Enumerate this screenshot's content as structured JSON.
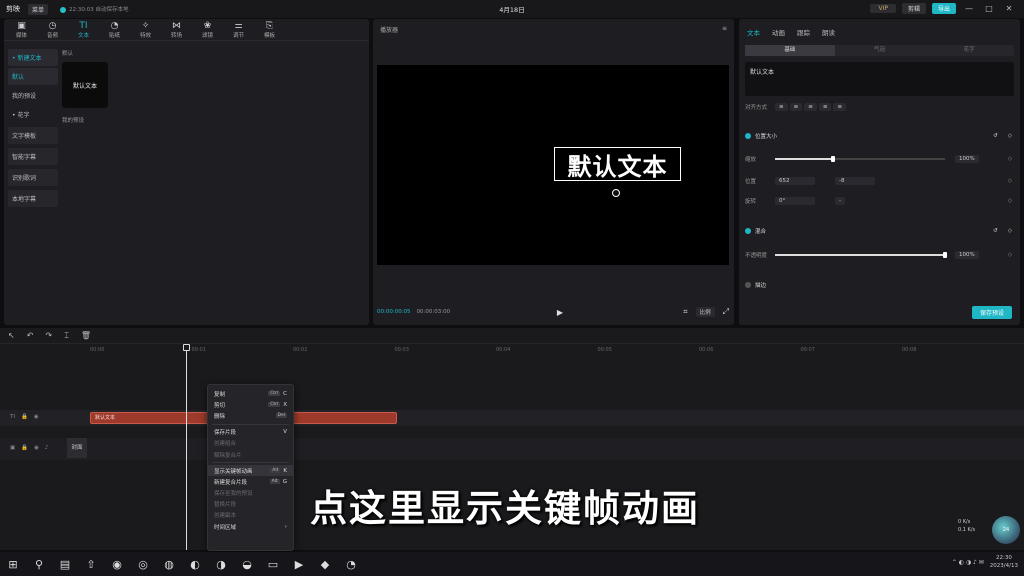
{
  "titlebar": {
    "app": "剪映",
    "menu": "菜单",
    "save_status": "22:30:03 自动保存本地",
    "date": "4月18日",
    "vip": "VIP",
    "share": "剪辑",
    "export": "导出",
    "win_min": "—",
    "win_max": "□",
    "win_close": "✕"
  },
  "left_toolbar": [
    {
      "label": "媒体",
      "icon": "▣"
    },
    {
      "label": "音频",
      "icon": "◷"
    },
    {
      "label": "文本",
      "icon": "TI",
      "active": true
    },
    {
      "label": "贴纸",
      "icon": "◔"
    },
    {
      "label": "特效",
      "icon": "✧"
    },
    {
      "label": "转场",
      "icon": "⋈"
    },
    {
      "label": "滤镜",
      "icon": "❀"
    },
    {
      "label": "调节",
      "icon": "⚌"
    },
    {
      "label": "模板",
      "icon": "⎘"
    }
  ],
  "categories": [
    {
      "label": "• 新建文本",
      "active": true
    },
    {
      "label": "默认",
      "active": true
    },
    {
      "label": "我的预设"
    },
    {
      "label": "• 花字"
    },
    {
      "label": "文字模板",
      "box": true
    },
    {
      "label": "智能字幕",
      "box": true
    },
    {
      "label": "识别歌词",
      "box": true
    },
    {
      "label": "本地字幕",
      "box": true
    }
  ],
  "presets": {
    "default_label": "默认",
    "card_text": "默认文本",
    "mine_label": "我的预设"
  },
  "preview": {
    "title": "播放器",
    "menu_icon": "≡",
    "text": "默认文本",
    "time_current": "00:00:00:05",
    "time_total": "00:00:03:00",
    "play_icon": "▶",
    "crop_icon": "⌗",
    "ratio": "比例",
    "fullscreen_icon": "⤢"
  },
  "props": {
    "tabs": [
      {
        "label": "文本",
        "on": true
      },
      {
        "label": "动画"
      },
      {
        "label": "跟踪"
      },
      {
        "label": "朗读"
      }
    ],
    "subtabs": [
      {
        "label": "基础",
        "on": true
      },
      {
        "label": "气泡"
      },
      {
        "label": "花字"
      }
    ],
    "text_value": "默认文本",
    "align_label": "对齐方式",
    "scale_section": "位置大小",
    "scale_label": "缩放",
    "scale_value": "100%",
    "scale_fraction": 0.34,
    "pos_label": "位置",
    "pos_x": "652",
    "pos_y": "-8",
    "rot_label": "旋转",
    "rot_value": "0°",
    "rot_extra": "-",
    "mix_section": "混合",
    "opacity_label": "不透明度",
    "opacity_value": "100%",
    "opacity_fraction": 1.0,
    "stroke_section": "描边",
    "apply_btn": "保存预设"
  },
  "timeline": {
    "ruler": [
      "00:00",
      "00:01",
      "00:02",
      "00:03",
      "00:04",
      "00:05",
      "00:06",
      "00:07",
      "00:08"
    ],
    "clip_label": "默认文本",
    "cover_label": "封面",
    "tools": [
      "↖",
      "↶",
      "↷",
      "⌶",
      "🗑"
    ]
  },
  "context_menu": [
    {
      "label": "复制",
      "keys": [
        "Ctrl",
        "C"
      ]
    },
    {
      "label": "剪切",
      "keys": [
        "Ctrl",
        "X"
      ]
    },
    {
      "label": "删除",
      "keys": [
        "Del"
      ]
    },
    {
      "sep": true
    },
    {
      "label": "保存片段",
      "keys": [
        "V"
      ]
    },
    {
      "label": "创建组合",
      "dis": true
    },
    {
      "label": "解除复合片",
      "dis": true
    },
    {
      "sep": true
    },
    {
      "label": "显示关键帧动画",
      "keys": [
        "Alt",
        "K"
      ],
      "hl": true
    },
    {
      "label": "新建复合片段",
      "keys": [
        "Alt",
        "G"
      ]
    },
    {
      "label": "保存至我的预设",
      "dis": true
    },
    {
      "label": "替换片段",
      "dis": true
    },
    {
      "label": "创建副本",
      "dis": true
    },
    {
      "label": "时间区域",
      "keys": [
        "›"
      ]
    }
  ],
  "subtitle": "点这里显示关键帧动画",
  "taskbar": {
    "icons": [
      "⊞",
      "⚲",
      "▤",
      "⇧",
      "◉",
      "◎",
      "◍",
      "◐",
      "◑",
      "◒",
      "▭",
      "▶",
      "◆",
      "◔"
    ],
    "time": "22:30",
    "date": "2023/4/13",
    "net_up": "0 K/s",
    "net_down": "0.1 K/s",
    "net_ball": "24"
  }
}
